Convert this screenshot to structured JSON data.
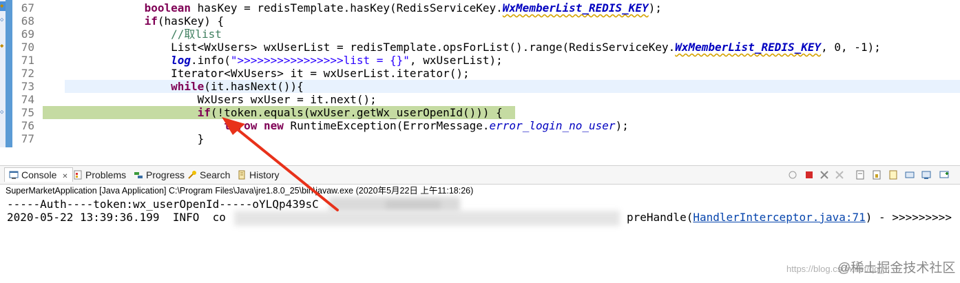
{
  "editor": {
    "lines": [
      {
        "num": "67",
        "pre": "            ",
        "segments": [
          [
            "kw",
            "boolean"
          ],
          [
            "",
            ""
          ],
          [
            "",
            " hasKey = redisTemplate.hasKey(RedisServiceKey."
          ],
          [
            "fld",
            "WxMemberList_REDIS_KEY"
          ],
          [
            "",
            ");"
          ]
        ]
      },
      {
        "num": "68",
        "pre": "            ",
        "segments": [
          [
            "kw",
            "if"
          ],
          [
            "",
            "(hasKey) {"
          ]
        ]
      },
      {
        "num": "69",
        "pre": "                ",
        "segments": [
          [
            "cm",
            "//取list"
          ]
        ]
      },
      {
        "num": "70",
        "pre": "                ",
        "segments": [
          [
            "",
            "List<WxUsers> wxUserList = redisTemplate.opsForList().range(RedisServiceKey."
          ],
          [
            "fld",
            "WxMemberList_REDIS_KEY"
          ],
          [
            "",
            ", 0, -1);"
          ]
        ]
      },
      {
        "num": "71",
        "pre": "                ",
        "segments": [
          [
            "fld",
            "log"
          ],
          [
            "",
            ".info("
          ],
          [
            "st",
            "\">>>>>>>>>>>>>>>>list = {}\""
          ],
          [
            "",
            ", wxUserList);"
          ]
        ]
      },
      {
        "num": "72",
        "pre": "                ",
        "segments": [
          [
            "",
            "Iterator<WxUsers> it = wxUserList.iterator();"
          ]
        ]
      },
      {
        "num": "73",
        "pre": "                ",
        "segments": [
          [
            "kw",
            "while"
          ],
          [
            "",
            "(it.hasNext()){"
          ]
        ]
      },
      {
        "num": "74",
        "pre": "                    ",
        "segments": [
          [
            "",
            "WxUsers wxUser = it.next();"
          ]
        ]
      },
      {
        "num": "75",
        "pre": "                    ",
        "segments": [
          [
            "kw",
            "if"
          ],
          [
            "",
            "(!token.equals(wxUser.getWx_userOpenId())) {"
          ]
        ]
      },
      {
        "num": "76",
        "pre": "                        ",
        "segments": [
          [
            "kw",
            "throw"
          ],
          [
            "",
            " "
          ],
          [
            "kw",
            "new"
          ],
          [
            "",
            " RuntimeException(ErrorMessage."
          ],
          [
            "fi",
            "error_login_no_user"
          ],
          [
            "",
            ");"
          ]
        ]
      },
      {
        "num": "77",
        "pre": "                    ",
        "segments": [
          [
            "",
            "}"
          ]
        ]
      }
    ]
  },
  "views": {
    "tabs": [
      "Console",
      "Problems",
      "Progress",
      "Search",
      "History"
    ],
    "console_close": "✕"
  },
  "console": {
    "launch": "SuperMarketApplication [Java Application] C:\\Program Files\\Java\\jre1.8.0_25\\bin\\javaw.exe (2020年5月22日 上午11:18:26)",
    "out1": "-----Auth----token:wx_userOpenId-----oYLQp439sC",
    "out2_prefix": "2020-05-22 13:39:36.199  INFO  co",
    "out2_mid_suffix": "preHandle(",
    "out2_link": "HandlerInterceptor.java:71",
    "out2_tail": ") - >>>>>>>>>"
  },
  "watermark": {
    "url": "https://blog.csdn.net/qq_",
    "brand": "@稀土掘金技术社区"
  },
  "colors": {
    "keyword": "#7f0055",
    "static_field": "#0000c0",
    "comment": "#3f7f5f",
    "string": "#2a00ff",
    "current_line": "#c5dba2",
    "arrow": "#e8311a"
  }
}
